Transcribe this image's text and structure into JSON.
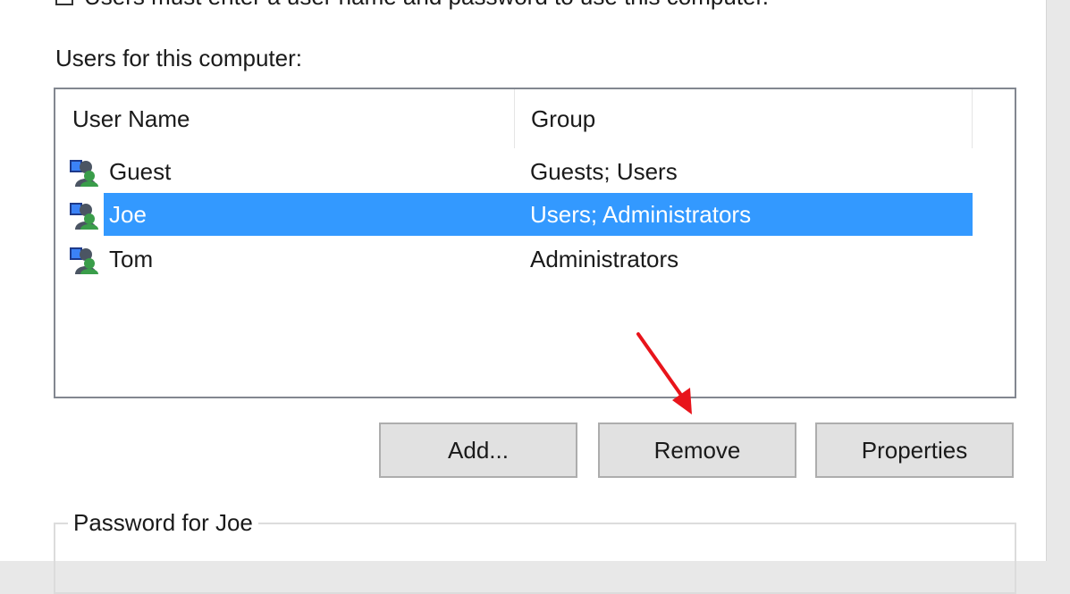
{
  "top_checkbox": {
    "label": "Users must enter a user name and password to use this computer.",
    "checked": false
  },
  "users_label": "Users for this computer:",
  "list": {
    "columns": [
      "User Name",
      "Group"
    ],
    "rows": [
      {
        "name": "Guest",
        "group": "Guests; Users",
        "icon": "user-group-icon",
        "selected": false
      },
      {
        "name": "Joe",
        "group": "Users; Administrators",
        "icon": "user-group-icon",
        "selected": true
      },
      {
        "name": "Tom",
        "group": "Administrators",
        "icon": "user-group-icon",
        "selected": false
      }
    ]
  },
  "buttons": {
    "add": "Add...",
    "remove": "Remove",
    "properties": "Properties"
  },
  "password_group": {
    "label": "Password for Joe"
  },
  "colors": {
    "selection": "#3399ff",
    "annotation_arrow": "#e8141b"
  }
}
